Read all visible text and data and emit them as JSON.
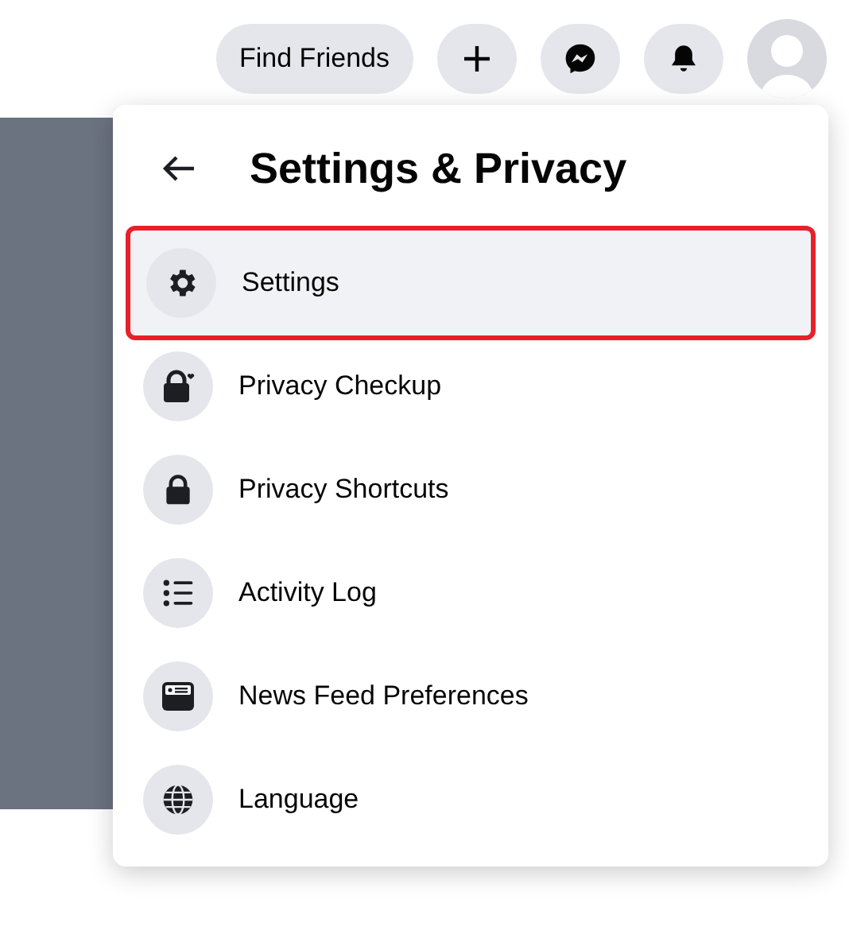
{
  "top_bar": {
    "find_friends": "Find Friends"
  },
  "menu": {
    "title": "Settings & Privacy",
    "items": [
      {
        "kind": "settings",
        "label": "Settings",
        "selected": true
      },
      {
        "kind": "checkup",
        "label": "Privacy Checkup",
        "selected": false
      },
      {
        "kind": "shortcuts",
        "label": "Privacy Shortcuts",
        "selected": false
      },
      {
        "kind": "activity",
        "label": "Activity Log",
        "selected": false
      },
      {
        "kind": "feed",
        "label": "News Feed Preferences",
        "selected": false
      },
      {
        "kind": "language",
        "label": "Language",
        "selected": false
      }
    ]
  }
}
